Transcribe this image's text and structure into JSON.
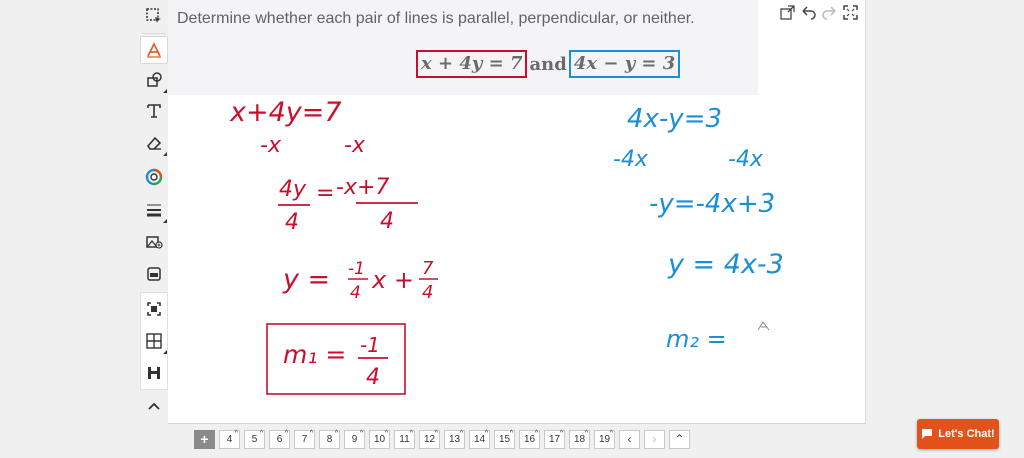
{
  "question": {
    "text": "Determine whether each pair of lines is parallel, perpendicular, or neither.",
    "eq1": "x + 4y = 7",
    "and": "and",
    "eq2": "4x − y = 3"
  },
  "colors": {
    "red_ink": "#c8102e",
    "blue_ink": "#1a8fd6",
    "chat": "#e2531b"
  },
  "work_left": {
    "line1": "x+4y=7",
    "line2a": "-x",
    "line2b": "-x",
    "frac_num_left": "4y",
    "frac_den_left": "4",
    "eq_sign": "=",
    "frac_num_right": "-x+7",
    "frac_den_right": "4",
    "y_label": "y =",
    "slope_num": "-1",
    "slope_den": "4",
    "x_plus": "x +",
    "const_num": "7",
    "const_den": "4",
    "m1_label": "m₁ =",
    "m1_num": "-1",
    "m1_den": "4"
  },
  "work_right": {
    "line1": "4x-y=3",
    "line2a": "-4x",
    "line2b": "-4x",
    "line3": "-y=-4x+3",
    "line4": "y = 4x-3",
    "m2": "m₂ ="
  },
  "tools": [
    "select-icon",
    "pen-icon",
    "shape-icon",
    "text-icon",
    "eraser-icon",
    "color-icon",
    "line-width-icon",
    "image-icon",
    "gallery-icon",
    "screenshot-icon",
    "grid-icon",
    "save-icon",
    "collapse-icon"
  ],
  "pages": [
    "4",
    "5",
    "6",
    "7",
    "8",
    "9",
    "10",
    "11",
    "12",
    "13",
    "14",
    "15",
    "16",
    "17",
    "18",
    "19"
  ],
  "chat_label": "Let's Chat!"
}
